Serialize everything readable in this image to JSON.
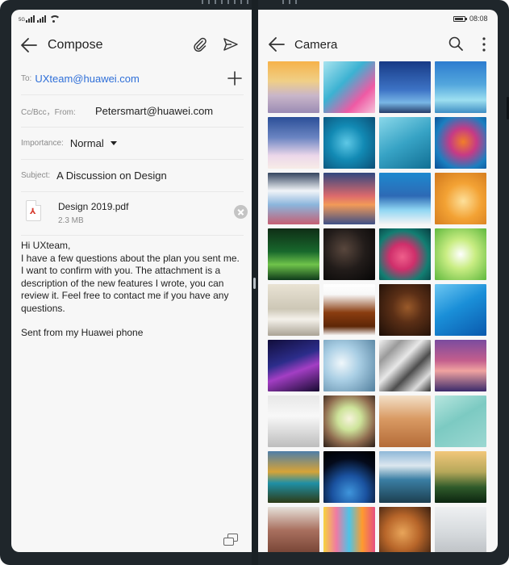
{
  "left_pane": {
    "status": {
      "network_label": "5G"
    },
    "appbar": {
      "title": "Compose"
    },
    "to": {
      "label": "To:",
      "value": "UXteam@huawei.com"
    },
    "ccbcc": {
      "label": "Cc/Bcc，From:",
      "value": "Petersmart@huawei.com"
    },
    "importance": {
      "label": "Importance:",
      "value": "Normal"
    },
    "subject": {
      "label": "Subject:",
      "value": "A Discussion on Design"
    },
    "attachment": {
      "name": "Design 2019.pdf",
      "size": "2.3 MB"
    },
    "body": {
      "greeting": "Hi UXteam,",
      "paragraph": "I have a few questions about the plan you sent me. I want to confirm with you. The attachment is a description of the new features I wrote, you can review it. Feel free to contact me if you have any questions.",
      "signature": "Sent from my Huawei phone"
    }
  },
  "right_pane": {
    "status": {
      "time": "08:08"
    },
    "appbar": {
      "title": "Camera"
    },
    "thumbnails": [
      {
        "name": "sunset-clouds-photo",
        "gradient": "linear-gradient(180deg,#f6b24a 0%,#f0cf86 38%,#c9b6c9 66%,#9b8bb4 100%)"
      },
      {
        "name": "pink-ice-photo",
        "gradient": "linear-gradient(135deg,#a8e3ef 0%,#3cb2d2 40%,#ef5aa4 72%,#f4c3da 100%)"
      },
      {
        "name": "night-sky-photo",
        "gradient": "linear-gradient(180deg,#173a86 0%,#3d73c5 55%,#78b6e5 80%,#253d6a 100%)"
      },
      {
        "name": "calm-lake-photo",
        "gradient": "linear-gradient(180deg,#2d7ccf 0%,#53a7dd 45%,#9ddff0 75%,#3f8fc4 100%)"
      },
      {
        "name": "winter-shore-photo",
        "gradient": "linear-gradient(180deg,#2b4f98 0%,#6b85c2 40%,#ecd7ea 75%,#f7ece7 100%)"
      },
      {
        "name": "boat-aerial-photo",
        "gradient": "radial-gradient(circle at 45% 50%,#5ec8e6 0%,#128ab4 45%,#0b4f76 100%)"
      },
      {
        "name": "wave-curve-photo",
        "gradient": "linear-gradient(150deg,#8ad8ea 0%,#37a3c5 50%,#116f94 100%)"
      },
      {
        "name": "smoke-splash-photo",
        "gradient": "radial-gradient(circle at 55% 48%,#f17e28 0%,#c63a86 34%,#1a7fc0 70%,#0c4f95 100%)"
      },
      {
        "name": "mountain-lake-photo",
        "gradient": "linear-gradient(180deg,#33445e 0%,#f1f4f8 35%,#8bb5dc 62%,#c55f73 100%)"
      },
      {
        "name": "sunset-coast-photo",
        "gradient": "linear-gradient(180deg,#30477f 0%,#dd6a6c 45%,#f29a58 62%,#3e4f86 100%)"
      },
      {
        "name": "blue-shore-photo",
        "gradient": "linear-gradient(180deg,#1d89cf 0%,#2d6ab5 45%,#8fd6f3 72%,#f4f4f4 100%)"
      },
      {
        "name": "golden-petals-photo",
        "gradient": "radial-gradient(circle at 55% 55%,#fde09a 0%,#f3a234 45%,#d0771c 100%)"
      },
      {
        "name": "green-leaves-photo",
        "gradient": "linear-gradient(180deg,#0f2e16 0%,#18682c 45%,#6fc34a 70%,#0e3a1a 100%)"
      },
      {
        "name": "dark-portrait-photo",
        "gradient": "radial-gradient(circle at 40% 40%,#59473d 0%,#221c1a 48%,#050505 100%)"
      },
      {
        "name": "pink-flowers-photo",
        "gradient": "radial-gradient(circle at 45% 55%,#ef5f8b 0%,#cf2f6b 32%,#127e72 65%,#083c40 100%)"
      },
      {
        "name": "bright-leaves-photo",
        "gradient": "radial-gradient(circle at 50% 50%,#ffffff 0%,#c9ed83 40%,#5fb83d 100%)"
      },
      {
        "name": "living-room-photo",
        "gradient": "linear-gradient(180deg,#e9e3d4 0%,#cdc7b6 48%,#f4f1ea 68%,#aaa395 100%)"
      },
      {
        "name": "violin-photo",
        "gradient": "linear-gradient(180deg,#ffffff 0%,#f8f8f8 20%,#8a3d10 55%,#5e2606 82%,#ffffff 100%)"
      },
      {
        "name": "violin-closeup-photo",
        "gradient": "radial-gradient(circle at 55% 45%,#9a5a2a 0%,#5b2f16 38%,#1c0e07 100%)"
      },
      {
        "name": "blue-curves-photo",
        "gradient": "linear-gradient(150deg,#6dc7f2 0%,#1a8fd8 45%,#0a59ad 100%)"
      },
      {
        "name": "purple-streak-photo",
        "gradient": "linear-gradient(160deg,#110d3b 0%,#2c2d8b 40%,#a33ec4 60%,#160a30 100%)"
      },
      {
        "name": "water-ripple-photo",
        "gradient": "radial-gradient(circle at 35% 45%,#f0f7fb 0%,#a9cee4 40%,#53809e 100%)"
      },
      {
        "name": "metal-lines-photo",
        "gradient": "linear-gradient(135deg,#f2f2f2 0%,#9a9a9a 22%,#e8e8e8 42%,#4d4d4d 62%,#dcdcdc 82%,#2e2e2e 100%)"
      },
      {
        "name": "pier-sunset-photo",
        "gradient": "linear-gradient(180deg,#7a4b9f 0%,#c35e8d 40%,#f0a3a0 60%,#3a2a6b 100%)"
      },
      {
        "name": "white-orchid-photo",
        "gradient": "linear-gradient(180deg,#e7e7e7 0%,#f8f8f8 40%,#bdbdbd 100%)"
      },
      {
        "name": "drink-still-photo",
        "gradient": "radial-gradient(circle at 50% 45%,#f7f3dd 0%,#cde39a 30%,#8f6b4f 65%,#2b1e17 100%)"
      },
      {
        "name": "tea-cup-photo",
        "gradient": "linear-gradient(180deg,#f3e0c8 0%,#d99a63 45%,#b46b38 100%)"
      },
      {
        "name": "pool-water-photo",
        "gradient": "linear-gradient(150deg,#b7e6df 0%,#7ccac2 45%,#9cd8d2 100%)"
      },
      {
        "name": "autumn-valley-photo",
        "gradient": "linear-gradient(180deg,#4e7ea8 0%,#d6a338 40%,#1f8fa5 62%,#2d3b16 100%)"
      },
      {
        "name": "earth-from-space-photo",
        "gradient": "radial-gradient(circle at 50% 80%,#3f95db 0%,#1a52a0 35%,#040a1a 70%,#000000 100%)"
      },
      {
        "name": "alpine-lake-photo",
        "gradient": "linear-gradient(180deg,#8fb8d8 0%,#dce7ef 28%,#3b7fa4 55%,#1c3f50 100%)"
      },
      {
        "name": "pine-forest-photo",
        "gradient": "linear-gradient(180deg,#f2c77b 0%,#b6a85a 40%,#2f5a2a 70%,#0c2510 100%)"
      },
      {
        "name": "cabin-photo",
        "gradient": "linear-gradient(180deg,#e6e1da 0%,#a9705f 45%,#6c3b2c 100%)"
      },
      {
        "name": "macarons-photo",
        "gradient": "linear-gradient(90deg,#f6d33e 0%,#ef7aa3 25%,#4dc4e7 50%,#ff9b2e 75%,#e64f82 100%)"
      },
      {
        "name": "bread-photo",
        "gradient": "radial-gradient(circle at 45% 50%,#e8a55a 0%,#b8662a 45%,#3a1f10 100%)"
      },
      {
        "name": "snowy-branches-photo",
        "gradient": "linear-gradient(180deg,#eef0f2 0%,#d6dadd 50%,#b8bcc0 100%)"
      }
    ]
  }
}
